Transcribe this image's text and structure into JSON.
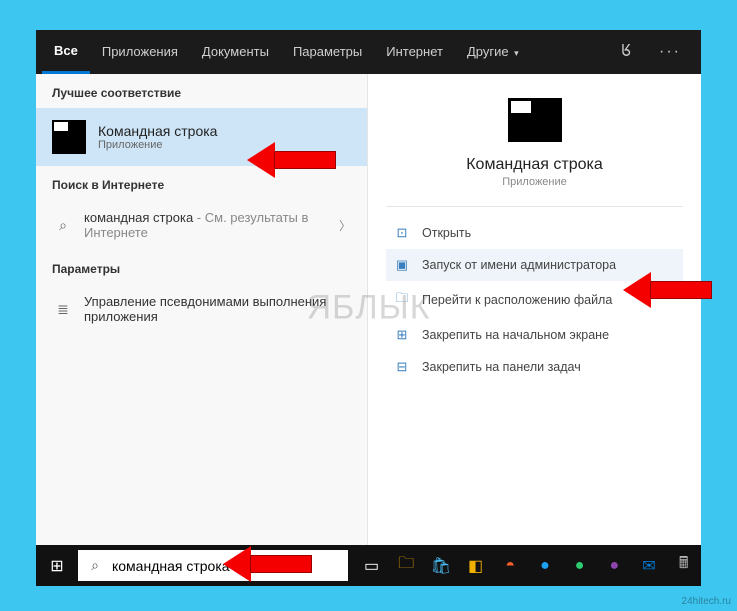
{
  "tabs": {
    "all": "Все",
    "apps": "Приложения",
    "docs": "Документы",
    "settings": "Параметры",
    "web": "Интернет",
    "more": "Другие"
  },
  "sections": {
    "best": "Лучшее соответствие",
    "web": "Поиск в Интернете",
    "settings": "Параметры"
  },
  "bestMatch": {
    "title": "Командная строка",
    "subtitle": "Приложение"
  },
  "webResult": {
    "query": "командная строка",
    "suffix": " - См. результаты в Интернете"
  },
  "settingsResult": {
    "label": "Управление псевдонимами выполнения приложения"
  },
  "preview": {
    "title": "Командная строка",
    "subtitle": "Приложение"
  },
  "actions": {
    "open": "Открыть",
    "runAdmin": "Запуск от имени администратора",
    "openLocation": "Перейти к расположению файла",
    "pinStart": "Закрепить на начальном экране",
    "pinTaskbar": "Закрепить на панели задач"
  },
  "search": {
    "value": "командная строка"
  },
  "watermark": "ЯБЛЫК",
  "credit": "24hitech.ru"
}
